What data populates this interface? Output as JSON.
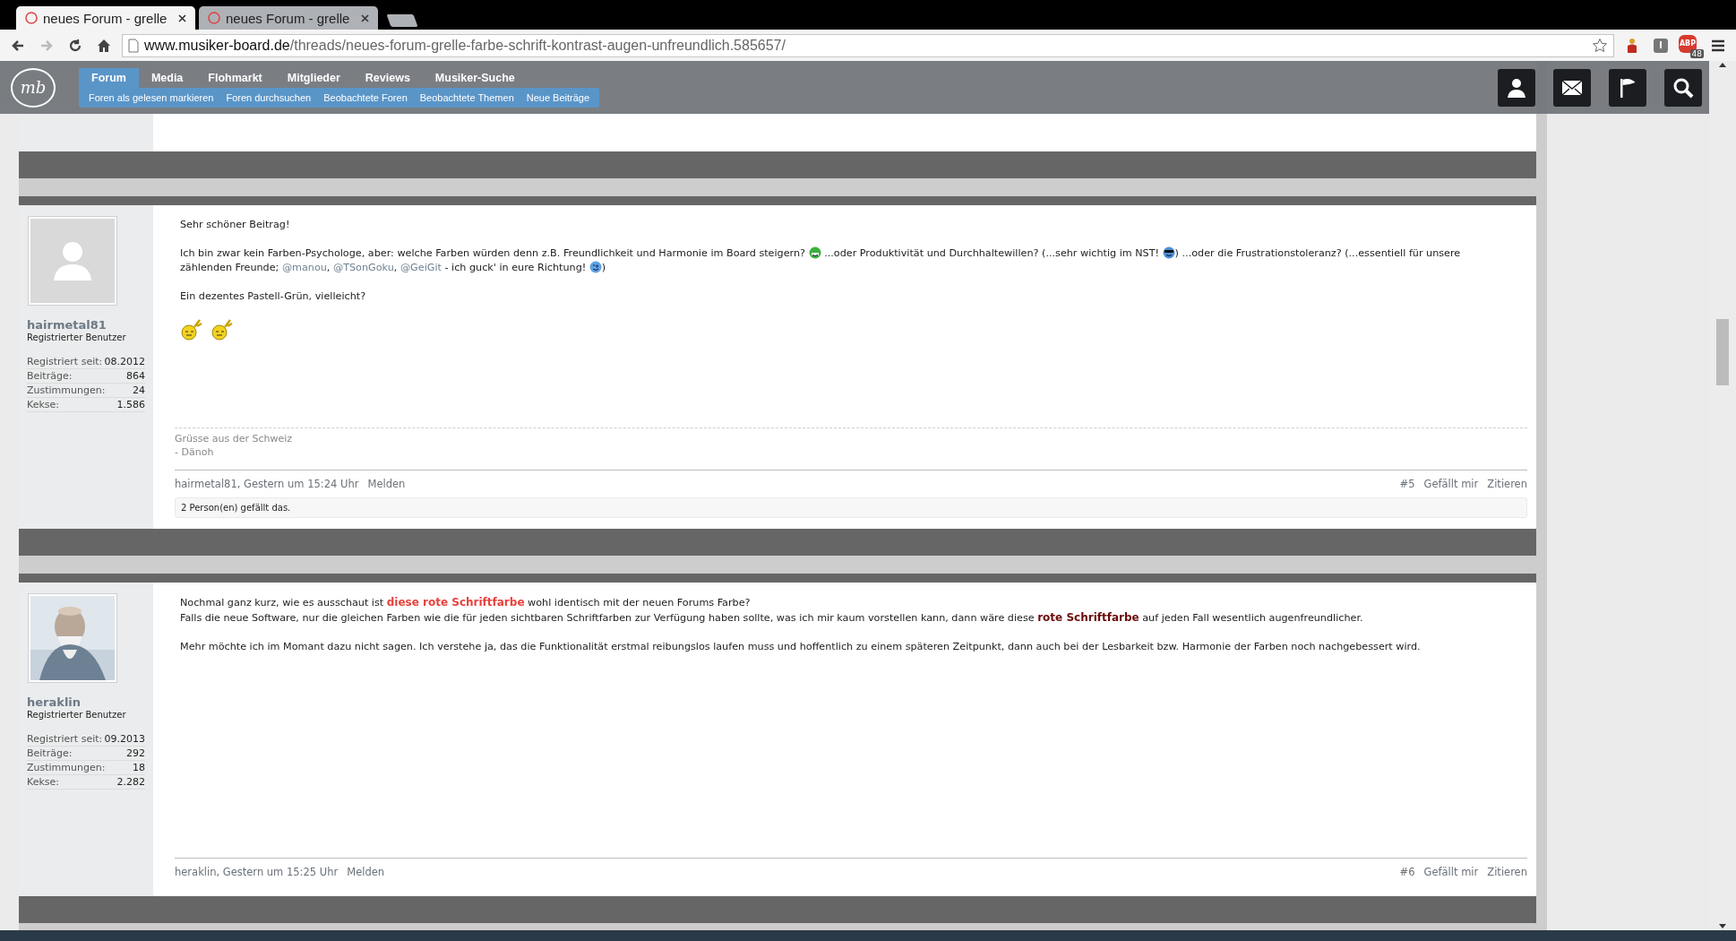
{
  "browser": {
    "tabs": [
      {
        "title": "neues Forum - grelle",
        "selected": true
      },
      {
        "title": "neues Forum - grelle",
        "selected": false
      }
    ],
    "url": {
      "host": "www.musiker-board.de",
      "path": "/threads/neues-forum-grelle-farbe-schrift-kontrast-augen-unfreundlich.585657/"
    },
    "forward_disabled": true,
    "adblock": {
      "label": "ABP",
      "count": "48"
    }
  },
  "nav": {
    "logo": "mb",
    "items": [
      {
        "label": "Forum",
        "selected": true
      },
      {
        "label": "Media",
        "selected": false
      },
      {
        "label": "Flohmarkt",
        "selected": false
      },
      {
        "label": "Mitglieder",
        "selected": false
      },
      {
        "label": "Reviews",
        "selected": false
      },
      {
        "label": "Musiker-Suche",
        "selected": false
      }
    ],
    "subnav": [
      "Foren als gelesen markieren",
      "Foren durchsuchen",
      "Beobachtete Foren",
      "Beobachtete Themen",
      "Neue Beiträge"
    ]
  },
  "posts": [
    {
      "author": "hairmetal81",
      "role": "Registrierter Benutzer",
      "avatar": {
        "kind": "placeholder"
      },
      "stats": [
        {
          "label": "Registriert seit:",
          "value": "08.2012"
        },
        {
          "label": "Beiträge:",
          "value": "864"
        },
        {
          "label": "Zustimmungen:",
          "value": "24"
        },
        {
          "label": "Kekse:",
          "value": "1.586"
        }
      ],
      "body": [
        {
          "kind": "text",
          "lines": [
            [
              {
                "kind": "text",
                "text": "Sehr schöner Beitrag!"
              }
            ]
          ]
        },
        {
          "kind": "text",
          "lines": [
            [
              {
                "kind": "text",
                "text": "Ich bin zwar kein Farben-Psychologe, aber: welche Farben würden denn z.B. Freundlichkeit und Harmonie im Board steigern? "
              },
              {
                "kind": "grin"
              },
              {
                "kind": "text",
                "text": " ...oder Produktivität und Durchhaltewillen? (...sehr wichtig im NST! "
              },
              {
                "kind": "cool"
              },
              {
                "kind": "text",
                "text": ") ...oder die Frustrationstoleranz? (...essentiell für unsere zählenden Freunde; "
              },
              {
                "kind": "mention",
                "text": "@manou"
              },
              {
                "kind": "text",
                "text": ", "
              },
              {
                "kind": "mention",
                "text": "@TSonGoku"
              },
              {
                "kind": "text",
                "text": ", "
              },
              {
                "kind": "mention",
                "text": "@GeiGit"
              },
              {
                "kind": "text",
                "text": " - ich guck' in eure Richtung! "
              },
              {
                "kind": "wink"
              },
              {
                "kind": "text",
                "text": ")"
              }
            ]
          ]
        },
        {
          "kind": "text",
          "lines": [
            [
              {
                "kind": "text",
                "text": "Ein dezentes Pastell-Grün, vielleicht?"
              }
            ]
          ]
        },
        {
          "kind": "smileys",
          "faces": [
            {
              "kind": "rocker"
            },
            {
              "kind": "rocker"
            }
          ]
        }
      ],
      "signature": [
        "Grüsse aus der Schweiz",
        "- Dänoh"
      ],
      "footer": {
        "meta": "hairmetal81, Gestern um 15:24 Uhr",
        "report": "Melden",
        "number": "#5",
        "like": "Gefällt mir",
        "quote": "Zitieren"
      },
      "likes": "2 Person(en) gefällt das."
    },
    {
      "author": "heraklin",
      "role": "Registrierter Benutzer",
      "avatar": {
        "kind": "picture"
      },
      "stats": [
        {
          "label": "Registriert seit:",
          "value": "09.2013"
        },
        {
          "label": "Beiträge:",
          "value": "292"
        },
        {
          "label": "Zustimmungen:",
          "value": "18"
        },
        {
          "label": "Kekse:",
          "value": "2.282"
        }
      ],
      "body": [
        {
          "kind": "text",
          "lines": [
            [
              {
                "kind": "text",
                "text": "Nochmal ganz kurz, wie es ausschaut ist "
              },
              {
                "kind": "colored",
                "text": "diese rote Schriftfarbe",
                "color": "#e8413c"
              },
              {
                "kind": "text",
                "text": " wohl identisch mit der neuen Forums Farbe?"
              }
            ],
            [
              {
                "kind": "text",
                "text": "Falls die neue Software, nur die gleichen Farben wie die für jeden sichtbaren Schriftfarben zur Verfügung haben sollte, was ich mir kaum vorstellen kann, dann wäre diese "
              },
              {
                "kind": "colored",
                "text": "rote Schriftfarbe",
                "color": "#6b0a0a"
              },
              {
                "kind": "text",
                "text": " auf jeden Fall wesentlich augenfreundlicher."
              }
            ]
          ]
        },
        {
          "kind": "text",
          "lines": [
            [
              {
                "kind": "text",
                "text": "Mehr möchte ich im Momant dazu nicht sagen. Ich verstehe ja, das die Funktionalität erstmal reibungslos laufen muss und hoffentlich zu einem späteren Zeitpunkt, dann auch bei der Lesbarkeit bzw. Harmonie der Farben noch nachgebessert wird."
              }
            ]
          ]
        }
      ],
      "footer": {
        "meta": "heraklin, Gestern um 15:25 Uhr",
        "report": "Melden",
        "number": "#6",
        "like": "Gefällt mir",
        "quote": "Zitieren"
      }
    }
  ]
}
